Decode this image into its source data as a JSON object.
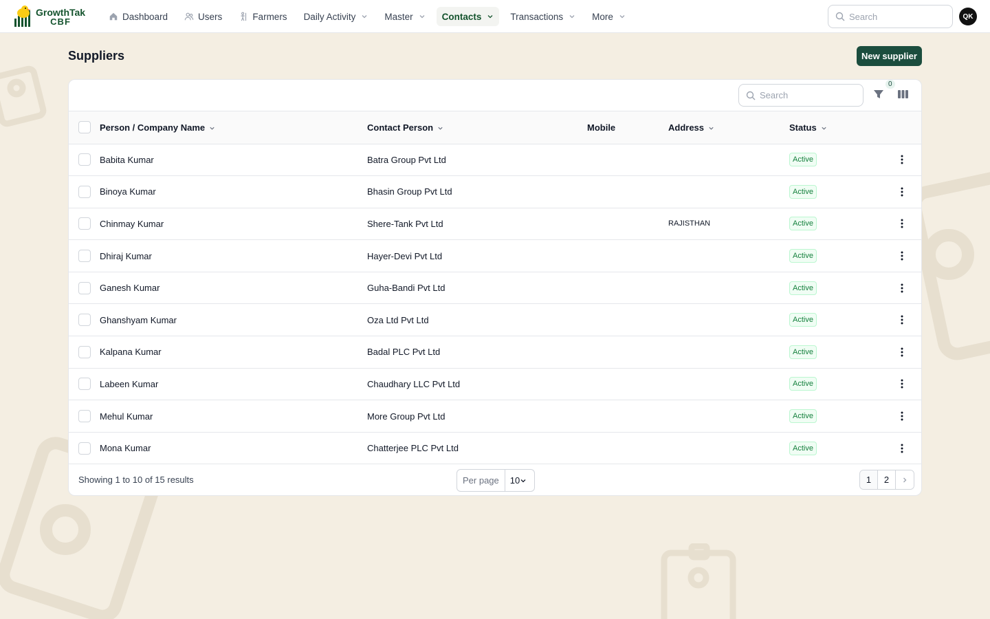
{
  "brand": {
    "name": "GrowthTak",
    "sub": "CBF"
  },
  "nav": [
    {
      "label": "Dashboard",
      "icon": "home-icon"
    },
    {
      "label": "Users",
      "icon": "users-icon"
    },
    {
      "label": "Farmers",
      "icon": "farmer-icon"
    },
    {
      "label": "Daily Activity",
      "dropdown": true
    },
    {
      "label": "Master",
      "dropdown": true
    },
    {
      "label": "Contacts",
      "dropdown": true,
      "active": true
    },
    {
      "label": "Transactions",
      "dropdown": true
    },
    {
      "label": "More",
      "dropdown": true
    }
  ],
  "top_search": {
    "placeholder": "Search"
  },
  "user": {
    "initials": "QK"
  },
  "page": {
    "title": "Suppliers",
    "new_button": "New supplier"
  },
  "table_toolbar": {
    "search_placeholder": "Search",
    "filter_count": "0"
  },
  "table": {
    "columns": [
      "Person / Company Name",
      "Contact Person",
      "Mobile",
      "Address",
      "Status"
    ],
    "rows": [
      {
        "name": "Babita Kumar",
        "contact": "Batra Group Pvt Ltd",
        "mobile": "",
        "address": "",
        "status": "Active"
      },
      {
        "name": "Binoya Kumar",
        "contact": "Bhasin Group Pvt Ltd",
        "mobile": "",
        "address": "",
        "status": "Active"
      },
      {
        "name": "Chinmay Kumar",
        "contact": "Shere-Tank Pvt Ltd",
        "mobile": "",
        "address": "RAJISTHAN",
        "status": "Active"
      },
      {
        "name": "Dhiraj Kumar",
        "contact": "Hayer-Devi Pvt Ltd",
        "mobile": "",
        "address": "",
        "status": "Active"
      },
      {
        "name": "Ganesh Kumar",
        "contact": "Guha-Bandi Pvt Ltd",
        "mobile": "",
        "address": "",
        "status": "Active"
      },
      {
        "name": "Ghanshyam Kumar",
        "contact": "Oza Ltd Pvt Ltd",
        "mobile": "",
        "address": "",
        "status": "Active"
      },
      {
        "name": "Kalpana Kumar",
        "contact": "Badal PLC Pvt Ltd",
        "mobile": "",
        "address": "",
        "status": "Active"
      },
      {
        "name": "Labeen Kumar",
        "contact": "Chaudhary LLC Pvt Ltd",
        "mobile": "",
        "address": "",
        "status": "Active"
      },
      {
        "name": "Mehul Kumar",
        "contact": "More Group Pvt Ltd",
        "mobile": "",
        "address": "",
        "status": "Active"
      },
      {
        "name": "Mona Kumar",
        "contact": "Chatterjee PLC Pvt Ltd",
        "mobile": "",
        "address": "",
        "status": "Active"
      }
    ]
  },
  "footer": {
    "results": "Showing 1 to 10 of 15 results",
    "per_page_label": "Per page",
    "per_page_value": "10",
    "pages": [
      "1",
      "2"
    ],
    "current_page": "1"
  },
  "colors": {
    "accent": "#1b4d3e",
    "background": "#f4eee2",
    "status_active": "#15803d"
  }
}
